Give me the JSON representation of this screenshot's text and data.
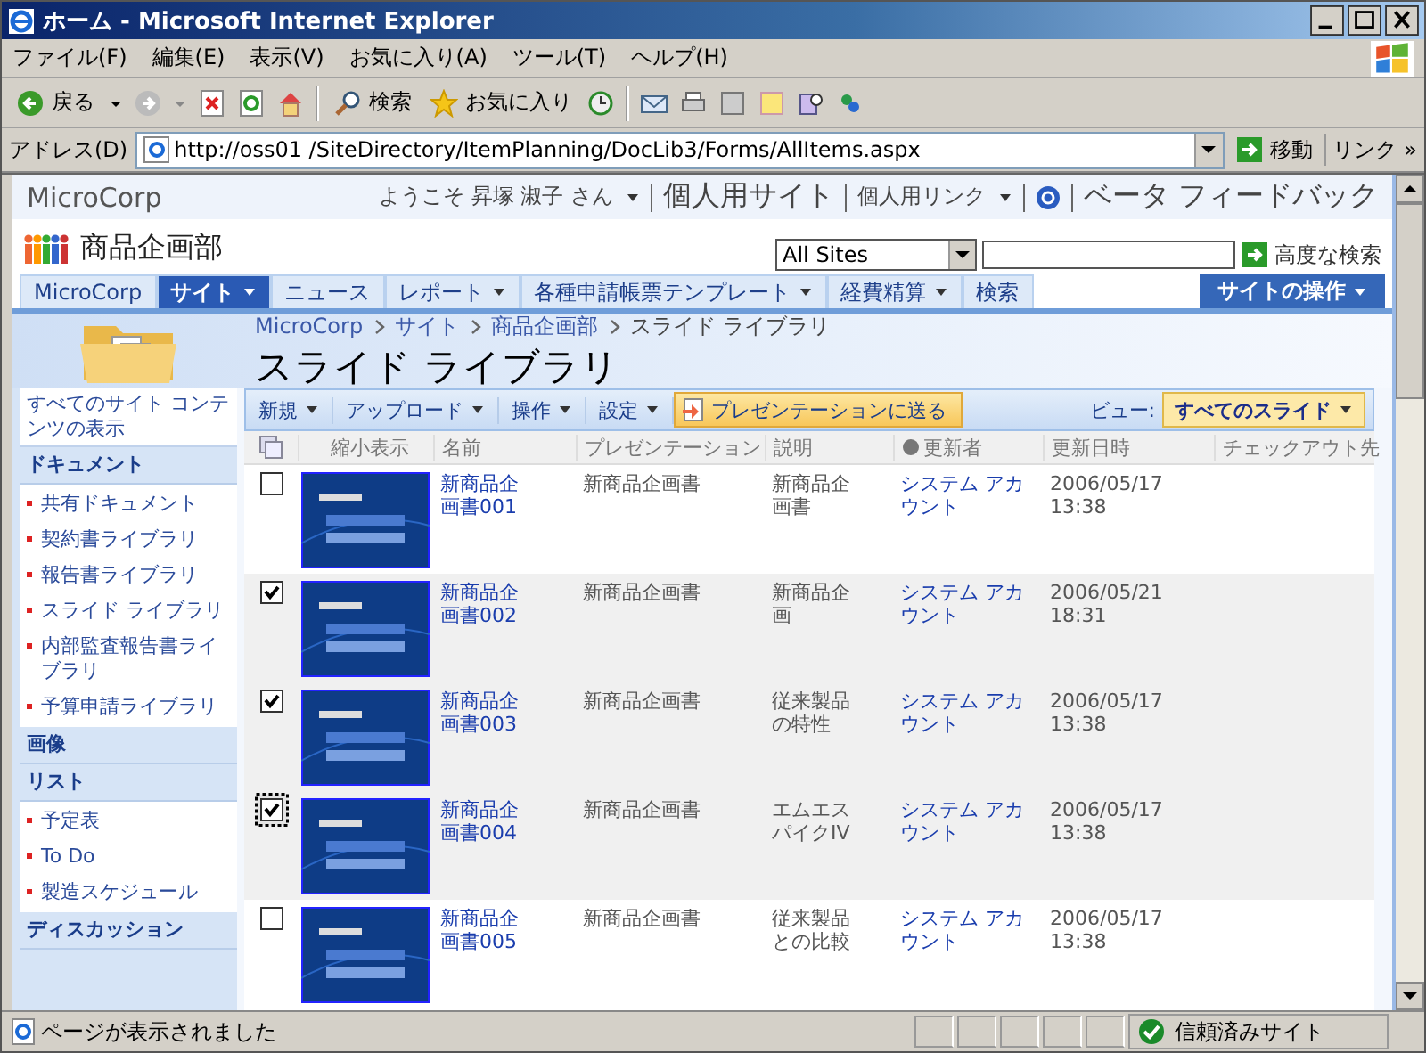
{
  "window": {
    "title": "ホーム - Microsoft Internet Explorer"
  },
  "menu_bar": [
    "ファイル(F)",
    "編集(E)",
    "表示(V)",
    "お気に入り(A)",
    "ツール(T)",
    "ヘルプ(H)"
  ],
  "toolbar": {
    "back": "戻る",
    "search": "検索",
    "favorites": "お気に入り"
  },
  "address_bar": {
    "label": "アドレス(D)",
    "url": "http://oss01 /SiteDirectory/ItemPlanning/DocLib3/Forms/AllItems.aspx",
    "go": "移動",
    "links": "リンク",
    "more": "»"
  },
  "header": {
    "brand": "MicroCorp",
    "welcome": "ようこそ 昇塚 淑子 さん",
    "my_site": "個人用サイト",
    "my_links": "個人用リンク",
    "feedback": "ベータ フィードバック"
  },
  "site": {
    "title": "商品企画部",
    "search_scope": "All Sites",
    "advanced_search": "高度な検索"
  },
  "nav_tabs": [
    {
      "label": "MicroCorp",
      "selected": false,
      "has_menu": false
    },
    {
      "label": "サイト",
      "selected": true,
      "has_menu": true
    },
    {
      "label": "ニュース",
      "selected": false,
      "has_menu": false
    },
    {
      "label": "レポート",
      "selected": false,
      "has_menu": true
    },
    {
      "label": "各種申請帳票テンプレート",
      "selected": false,
      "has_menu": true
    },
    {
      "label": "経費精算",
      "selected": false,
      "has_menu": true
    },
    {
      "label": "検索",
      "selected": false,
      "has_menu": false
    }
  ],
  "site_actions": "サイトの操作",
  "breadcrumb": [
    "MicroCorp",
    "サイト",
    "商品企画部",
    "スライド ライブラリ"
  ],
  "page_title": "スライド ライブラリ",
  "sidebar": {
    "view_all": "すべてのサイト コンテンツの表示",
    "sections": [
      {
        "heading": "ドキュメント",
        "items": [
          "共有ドキュメント",
          "契約書ライブラリ",
          "報告書ライブラリ",
          "スライド ライブラリ",
          "内部監査報告書ライブラリ",
          "予算申請ライブラリ"
        ]
      },
      {
        "heading": "画像"
      },
      {
        "heading": "リスト",
        "items": [
          "予定表",
          "To Do",
          "製造スケジュール"
        ]
      },
      {
        "heading": "ディスカッション"
      }
    ]
  },
  "list_toolbar": {
    "menus": [
      "新規",
      "アップロード",
      "操作",
      "設定"
    ],
    "send_button": "プレゼンテーションに送る",
    "view_label": "ビュー:",
    "view": "すべてのスライド"
  },
  "table": {
    "columns": [
      "縮小表示",
      "名前",
      "プレゼンテーション",
      "説明",
      "更新者",
      "更新日時",
      "チェックアウト先"
    ],
    "rows": [
      {
        "checked": false,
        "focused": false,
        "name": "新商品企画書001",
        "presentation": "新商品企画書",
        "description": "新商品企画書",
        "modified_by": "システム アカウント",
        "modified": "2006/05/17 13:38"
      },
      {
        "checked": true,
        "focused": false,
        "name": "新商品企画書002",
        "presentation": "新商品企画書",
        "description": "新商品企画",
        "modified_by": "システム アカウント",
        "modified": "2006/05/21 18:31"
      },
      {
        "checked": true,
        "focused": false,
        "name": "新商品企画書003",
        "presentation": "新商品企画書",
        "description": "従来製品の特性",
        "modified_by": "システム アカウント",
        "modified": "2006/05/17 13:38"
      },
      {
        "checked": true,
        "focused": true,
        "name": "新商品企画書004",
        "presentation": "新商品企画書",
        "description": "エムエスパイクIV",
        "modified_by": "システム アカウント",
        "modified": "2006/05/17 13:38"
      },
      {
        "checked": false,
        "focused": false,
        "name": "新商品企画書005",
        "presentation": "新商品企画書",
        "description": "従来製品との比較",
        "modified_by": "システム アカウント",
        "modified": "2006/05/17 13:38"
      }
    ]
  },
  "status_bar": {
    "message": "ページが表示されました",
    "zone": "信頼済みサイト"
  }
}
